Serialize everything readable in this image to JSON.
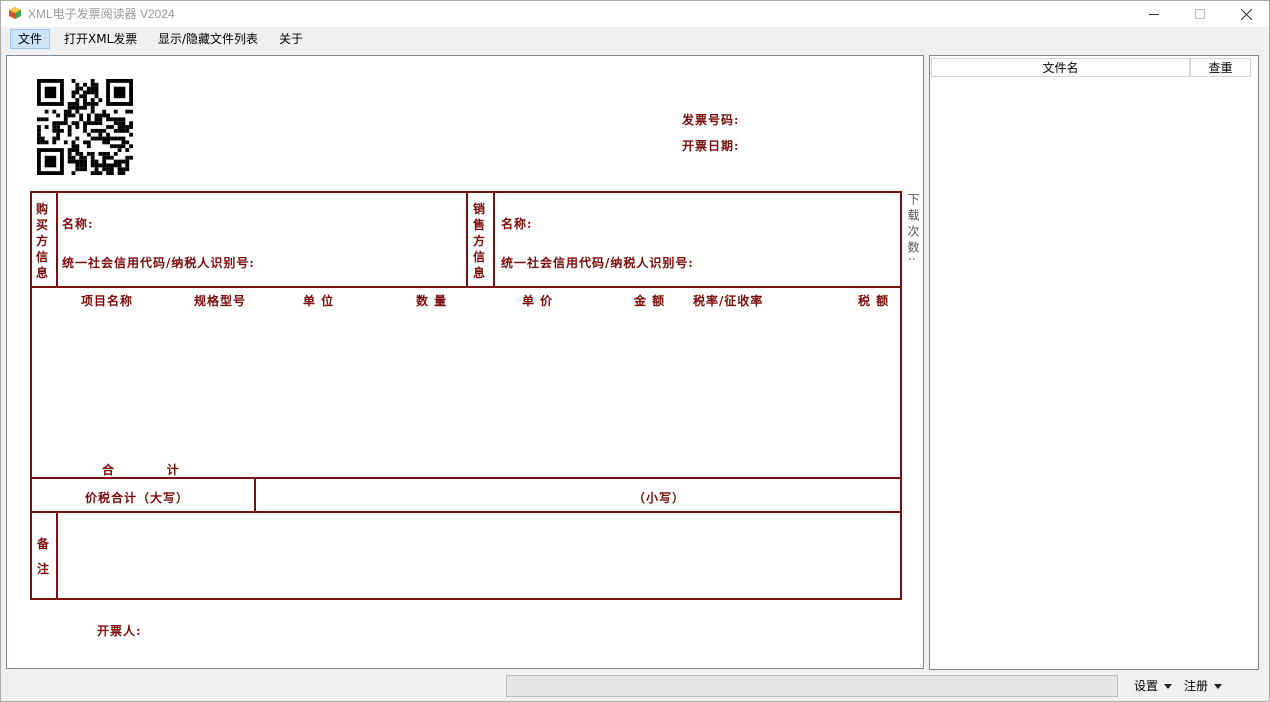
{
  "window": {
    "title": "XML电子发票阅读器 V2024"
  },
  "menu": {
    "file": "文件",
    "open_xml": "打开XML发票",
    "toggle_list": "显示/隐藏文件列表",
    "about": "关于"
  },
  "invoice": {
    "invoice_number_label": "发票号码:",
    "issue_date_label": "开票日期:",
    "buyer_side": "购买方信息",
    "seller_side": "销售方信息",
    "buyer_name_label": "名称:",
    "buyer_taxid_label": "统一社会信用代码/纳税人识别号:",
    "seller_name_label": "名称:",
    "seller_taxid_label": "统一社会信用代码/纳税人识别号:",
    "download_count_label": "下载次数:",
    "columns": {
      "item_name": "项目名称",
      "spec": "规格型号",
      "unit": "单 位",
      "quantity": "数 量",
      "unit_price": "单 价",
      "amount": "金 额",
      "tax_rate": "税率/征收率",
      "tax": "税 额"
    },
    "total_label": "合          计",
    "total_in_words_label": "价税合计（大写）",
    "total_in_figures_label": "（小写）",
    "remarks_label": "备注",
    "issuer_label": "开票人:"
  },
  "file_list": {
    "col_filename": "文件名",
    "col_duplicate": "查重"
  },
  "status": {
    "progress": 0,
    "settings": "设置",
    "register": "注册"
  },
  "colors": {
    "invoice_line": "#7b1010",
    "invoice_text": "#7b0c0c",
    "menu_active_bg": "#cce4f7"
  }
}
